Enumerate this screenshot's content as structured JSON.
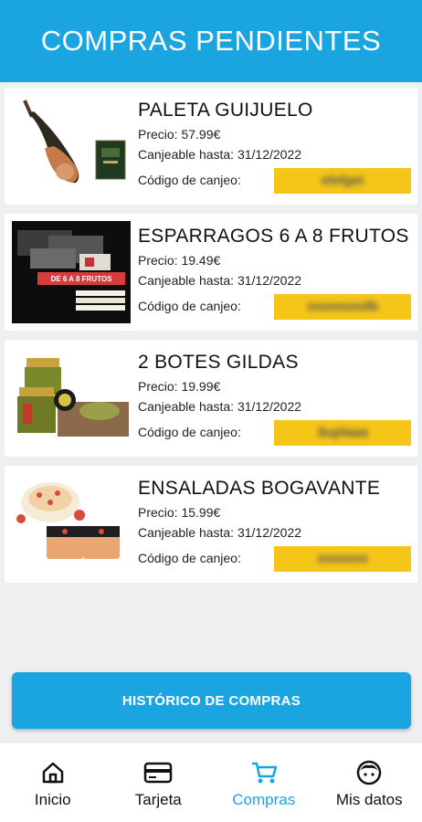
{
  "header": {
    "title": "COMPRAS PENDIENTES"
  },
  "purchases": [
    {
      "name": "PALETA GUIJUELO",
      "price": "Precio: 57.99€",
      "valid_until": "Canjeable hasta: 31/12/2022",
      "code_label": "Código de canjeo:",
      "code": "elelgei",
      "image": "ham-product-image"
    },
    {
      "name": "ESPARRAGOS 6 A 8 FRUTOS",
      "price": "Precio: 19.49€",
      "valid_until": "Canjeable hasta: 31/12/2022",
      "code_label": "Código de canjeo:",
      "code": "ooooooolb",
      "image": "asparagus-product-image",
      "image_text": "DE 6 A 8 FRUTOS"
    },
    {
      "name": "2 BOTES GILDAS",
      "price": "Precio: 19.99€",
      "valid_until": "Canjeable hasta: 31/12/2022",
      "code_label": "Código de canjeo:",
      "code": "3uplaaa",
      "image": "gildas-jars-image"
    },
    {
      "name": "ENSALADAS BOGAVANTE",
      "price": "Precio: 15.99€",
      "valid_until": "Canjeable hasta: 31/12/2022",
      "code_label": "Código de canjeo:",
      "code": "oooooo",
      "image": "lobster-salad-image"
    }
  ],
  "history_button": {
    "label": "HISTÓRICO DE COMPRAS"
  },
  "nav": [
    {
      "label": "Inicio",
      "icon": "home-icon"
    },
    {
      "label": "Tarjeta",
      "icon": "card-icon"
    },
    {
      "label": "Compras",
      "icon": "cart-icon",
      "active": true
    },
    {
      "label": "Mis datos",
      "icon": "face-icon"
    }
  ],
  "colors": {
    "primary": "#1ba5e0",
    "code_bg": "#f5c518",
    "background": "#eeeff1"
  }
}
